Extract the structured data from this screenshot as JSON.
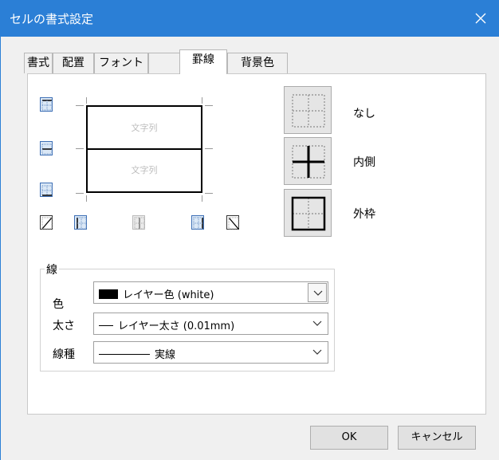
{
  "window": {
    "title": "セルの書式設定",
    "accent": "#2b7fd6"
  },
  "tabs": [
    {
      "label": "書式",
      "active": false
    },
    {
      "label": "配置",
      "active": false
    },
    {
      "label": "フォント",
      "active": false
    },
    {
      "label": "罫線",
      "active": true
    },
    {
      "label": "背景色",
      "active": false
    }
  ],
  "preview": {
    "cell_top": "文字列",
    "cell_bottom": "文字列"
  },
  "presets": {
    "none": "なし",
    "inside": "内側",
    "outline": "外枠"
  },
  "line_group": {
    "title": "線",
    "color_label": "色",
    "color_value": "レイヤー色 (white)",
    "width_label": "太さ",
    "width_value": "レイヤー太さ (0.01mm)",
    "style_label": "線種",
    "style_value": "実線"
  },
  "buttons": {
    "ok": "OK",
    "cancel": "キャンセル"
  }
}
